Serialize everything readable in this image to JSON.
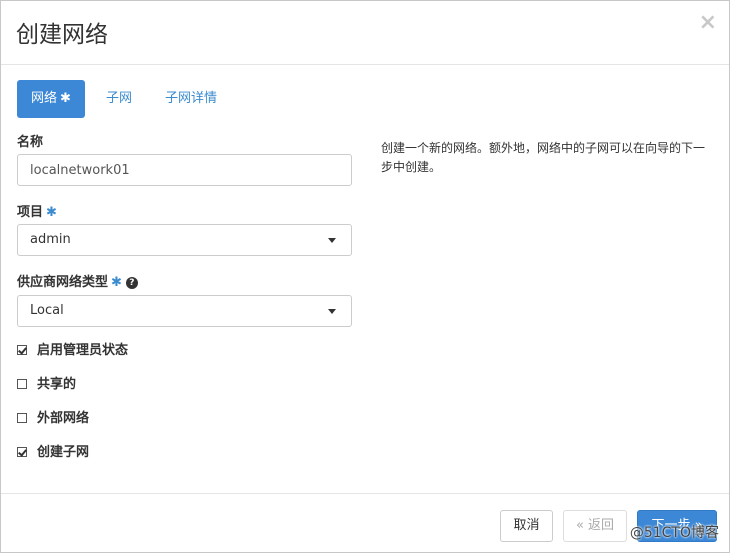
{
  "dialog": {
    "title": "创建网络",
    "close_symbol": "×"
  },
  "tabs": [
    {
      "label": "网络",
      "required_mark": "✱"
    },
    {
      "label": "子网"
    },
    {
      "label": "子网详情"
    }
  ],
  "form": {
    "name": {
      "label": "名称",
      "value": "localnetwork01"
    },
    "project": {
      "label": "项目",
      "required_mark": "✱",
      "selected": "admin"
    },
    "provider_type": {
      "label": "供应商网络类型",
      "required_mark": "✱",
      "help_symbol": "?",
      "selected": "Local"
    },
    "checkboxes": [
      {
        "label": "启用管理员状态",
        "checked": true
      },
      {
        "label": "共享的",
        "checked": false
      },
      {
        "label": "外部网络",
        "checked": false
      },
      {
        "label": "创建子网",
        "checked": true
      }
    ]
  },
  "description": "创建一个新的网络。额外地，网络中的子网可以在向导的下一步中创建。",
  "footer": {
    "cancel_label": "取消",
    "back_label": "« 返回",
    "next_label": "下一步 »"
  },
  "watermark": "@51CTO博客",
  "colors": {
    "primary": "#3d88d6",
    "link": "#3b8bd0"
  }
}
